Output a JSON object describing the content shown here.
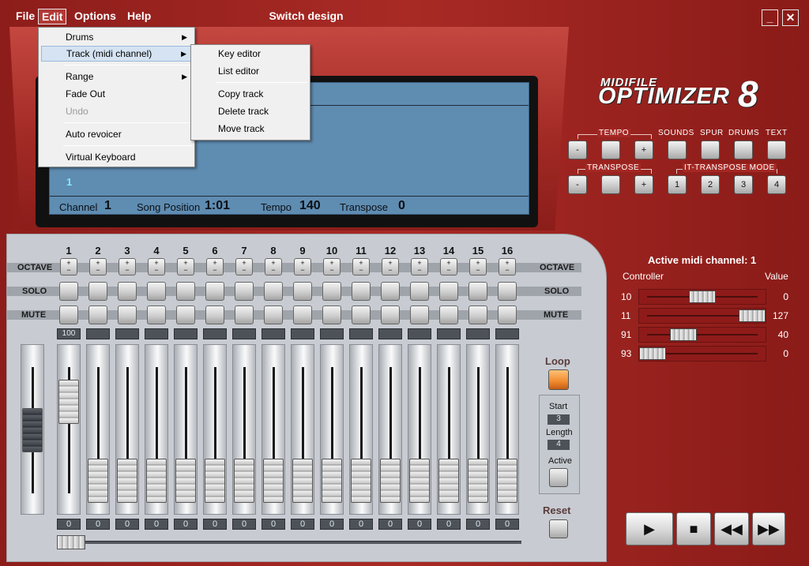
{
  "window": {
    "title": "Switch design",
    "minimize": "_",
    "close": "✕"
  },
  "menu": [
    "File",
    "Edit",
    "Options",
    "Help"
  ],
  "edit_menu": {
    "items": [
      {
        "label": "Drums",
        "arrow": "▶"
      },
      {
        "label": "Track (midi channel)",
        "arrow": "▶"
      },
      {
        "label": "Range",
        "arrow": "▶"
      },
      {
        "label": "Fade Out"
      },
      {
        "label": "Undo"
      },
      {
        "label": "Auto revoicer"
      },
      {
        "label": "Virtual Keyboard"
      }
    ]
  },
  "track_submenu": {
    "items": [
      "Key editor",
      "List editor",
      "Copy track",
      "Delete track",
      "Move track"
    ]
  },
  "lcd": {
    "channel_marker": "1",
    "channel_label": "Channel",
    "channel_value": "1",
    "position_label": "Song Position",
    "position_value": "1:01",
    "tempo_label": "Tempo",
    "tempo_value": "140",
    "transpose_label": "Transpose",
    "transpose_value": "0"
  },
  "logo": {
    "line1": "MIDIFILE",
    "line2": "OPTIMIZER",
    "digit": "8"
  },
  "controls": {
    "tempo_label": "TEMPO",
    "sounds_label": "SOUNDS",
    "spur_label": "SPUR",
    "drums_label": "DRUMS",
    "text_label": "TEXT",
    "transpose_label": "TRANSPOSE",
    "it_label": "IT-TRANSPOSE MODE",
    "minus": "-",
    "plus": "+",
    "it_buttons": [
      "1",
      "2",
      "3",
      "4"
    ]
  },
  "mixer": {
    "channels": [
      "1",
      "2",
      "3",
      "4",
      "5",
      "6",
      "7",
      "8",
      "9",
      "10",
      "11",
      "12",
      "13",
      "14",
      "15",
      "16"
    ],
    "row_labels": {
      "octave": "OCTAVE",
      "solo": "SOLO",
      "mute": "MUTE"
    },
    "octave_glyph_plus": "+",
    "octave_glyph_minus": "−",
    "master_level": "100",
    "levels": [
      "0",
      "0",
      "0",
      "0",
      "0",
      "0",
      "0",
      "0",
      "0",
      "0",
      "0",
      "0",
      "0",
      "0",
      "0",
      "0"
    ]
  },
  "loop": {
    "loop_label": "Loop",
    "start_label": "Start",
    "start_value": "3",
    "length_label": "Length",
    "length_value": "4",
    "active_label": "Active",
    "reset_label": "Reset"
  },
  "controllers": {
    "title": "Active midi channel: 1",
    "col_controller": "Controller",
    "col_value": "Value",
    "rows": [
      {
        "num": "10",
        "value": "0",
        "pos": 0.5
      },
      {
        "num": "11",
        "value": "127",
        "pos": 1.0
      },
      {
        "num": "91",
        "value": "40",
        "pos": 0.31
      },
      {
        "num": "93",
        "value": "0",
        "pos": 0.0
      }
    ]
  },
  "transport": [
    "▶",
    "■",
    "◀◀",
    "▶▶"
  ],
  "colors": {
    "frame": "#a92a25",
    "lcd": "#5f8cb1",
    "menu": "#f0f0f0",
    "loop_led": "#f08a2e"
  }
}
